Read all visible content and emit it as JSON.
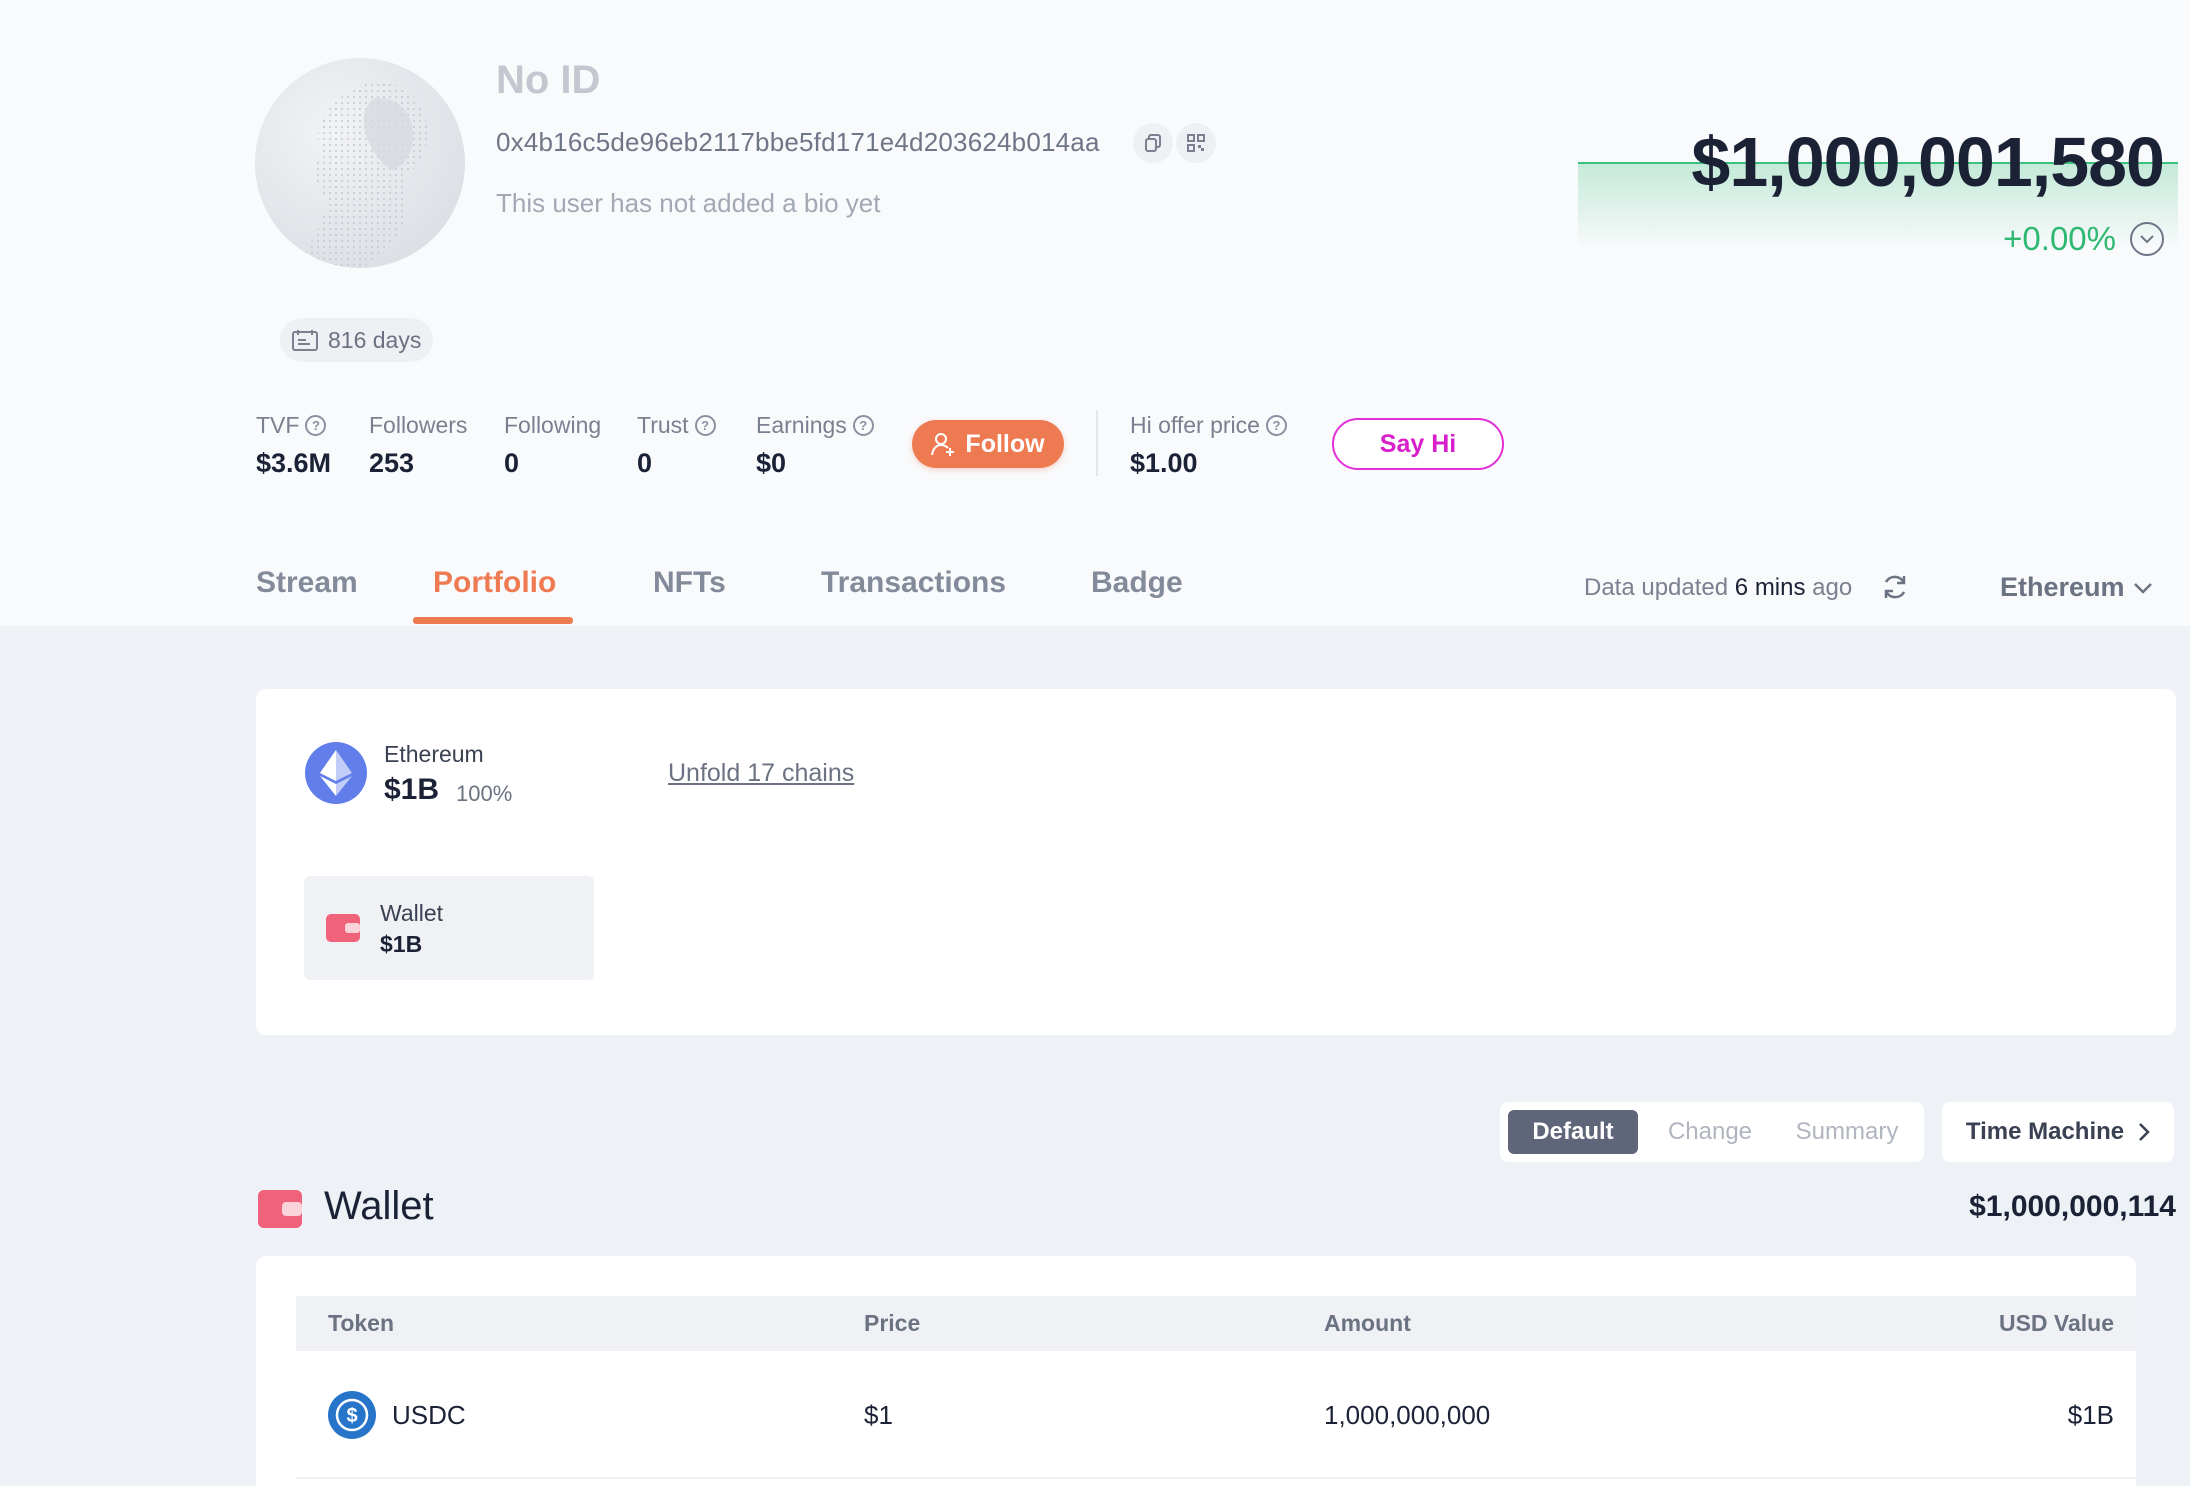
{
  "profile": {
    "name": "No ID",
    "address": "0x4b16c5de96eb2117bbe5fd171e4d203624b014aa",
    "bio": "This user has not added a bio yet",
    "days": "816 days"
  },
  "value": {
    "total": "$1,000,001,580",
    "change": "+0.00%",
    "change_color": "#2fb872"
  },
  "stats": [
    {
      "label": "TVF",
      "value": "$3.6M"
    },
    {
      "label": "Followers",
      "value": "253"
    },
    {
      "label": "Following",
      "value": "0"
    },
    {
      "label": "Trust",
      "value": "0"
    },
    {
      "label": "Earnings",
      "value": "$0"
    }
  ],
  "actions": {
    "follow": "Follow",
    "hi_offer_label": "Hi offer price",
    "hi_offer_value": "$1.00",
    "say_hi": "Say Hi"
  },
  "tabs": [
    "Stream",
    "Portfolio",
    "NFTs",
    "Transactions",
    "Badge"
  ],
  "active_tab": "Portfolio",
  "data_updated": {
    "prefix": "Data updated",
    "time": "6 mins",
    "suffix": "ago"
  },
  "chain_selector": "Ethereum",
  "chain_summary": {
    "name": "Ethereum",
    "value": "$1B",
    "pct": "100%",
    "unfold": "Unfold 17 chains",
    "wallet_label": "Wallet",
    "wallet_value": "$1B"
  },
  "view_toggle": {
    "options": [
      "Default",
      "Change",
      "Summary"
    ],
    "active": "Default",
    "time_machine": "Time Machine"
  },
  "wallet": {
    "title": "Wallet",
    "total": "$1,000,000,114",
    "columns": [
      "Token",
      "Price",
      "Amount",
      "USD Value"
    ],
    "rows": [
      {
        "token": "USDC",
        "price": "$1",
        "amount": "1,000,000,000",
        "usd_value": "$1B"
      }
    ]
  },
  "colors": {
    "accent": "#ee7a52",
    "say_hi": "#e22fd7",
    "eth": "#627eea",
    "usdc": "#2775ca",
    "wallet_icon": "#f0617a"
  }
}
